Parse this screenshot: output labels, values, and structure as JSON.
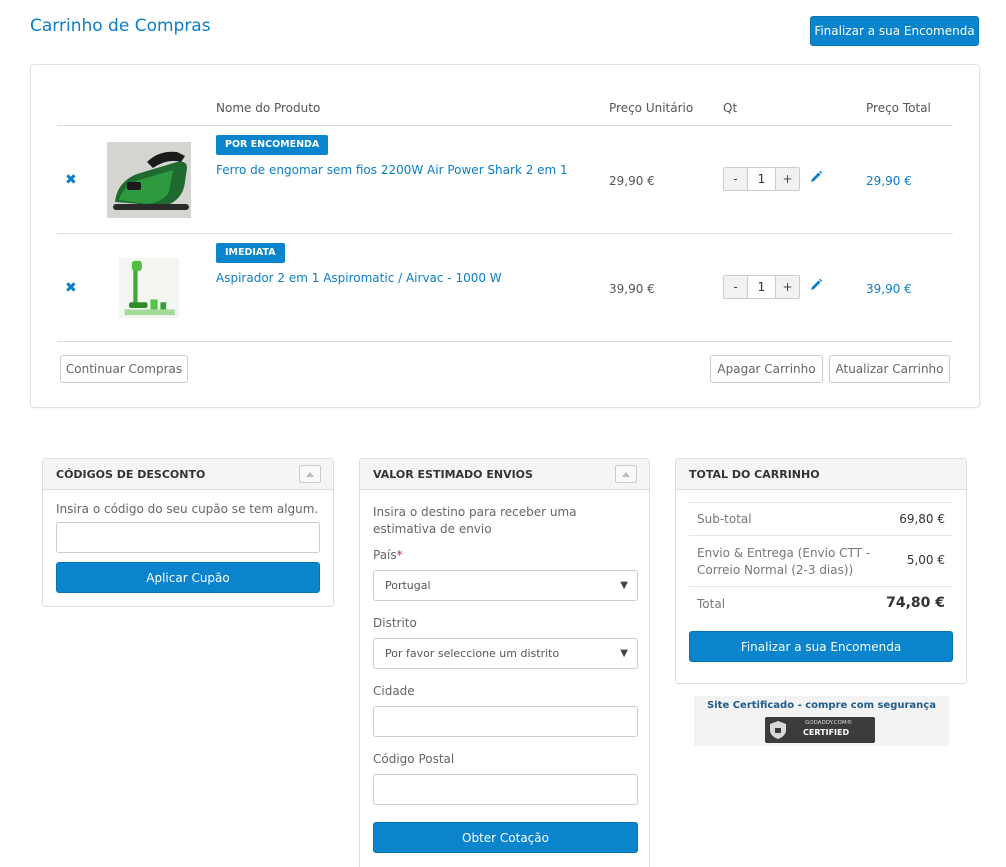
{
  "page": {
    "title": "Carrinho de Compras",
    "finalize_label": "Finalizar a sua Encomenda"
  },
  "cart": {
    "headers": {
      "product": "Nome do Produto",
      "unit_price": "Preço Unitário",
      "qty": "Qt",
      "total_price": "Preço Total"
    },
    "items": [
      {
        "badge": "POR ENCOMENDA",
        "name": "Ferro de engomar sem fios 2200W Air Power Shark 2 em 1",
        "unit_price": "29,90 €",
        "qty": "1",
        "total": "29,90 €"
      },
      {
        "badge": "IMEDIATA",
        "name": "Aspirador 2 em 1 Aspiromatic / Airvac - 1000 W",
        "unit_price": "39,90 €",
        "qty": "1",
        "total": "39,90 €"
      }
    ],
    "qty_minus": "-",
    "qty_plus": "+",
    "continue_label": "Continuar Compras",
    "clear_label": "Apagar Carrinho",
    "update_label": "Atualizar Carrinho"
  },
  "discount": {
    "title": "CÓDIGOS DE DESCONTO",
    "hint": "Insira o código do seu cupão se tem algum.",
    "apply_label": "Aplicar Cupão"
  },
  "shipping": {
    "title": "VALOR ESTIMADO ENVIOS",
    "hint": "Insira o destino para receber uma estimativa de envio",
    "country_label": "País",
    "required_mark": "*",
    "country_value": "Portugal",
    "district_label": "Distrito",
    "district_value": "Por favor seleccione um distrito",
    "city_label": "Cidade",
    "postcode_label": "Código Postal",
    "quote_label": "Obter Cotação"
  },
  "totals": {
    "title": "TOTAL DO CARRINHO",
    "subtotal_label": "Sub-total",
    "subtotal_value": "69,80 €",
    "shipping_label": "Envio & Entrega (Envio CTT - Correio Normal (2-3 dias))",
    "shipping_value": "5,00 €",
    "total_label": "Total",
    "total_value": "74,80 €",
    "finalize_label": "Finalizar a sua Encomenda"
  },
  "seal": {
    "text": "Site Certificado - compre com segurança",
    "badge_top": "GODADDY.COM®",
    "badge_main": "CERTIFIED"
  },
  "colors": {
    "accent": "#0a84cc",
    "link": "#0a7ec8"
  }
}
